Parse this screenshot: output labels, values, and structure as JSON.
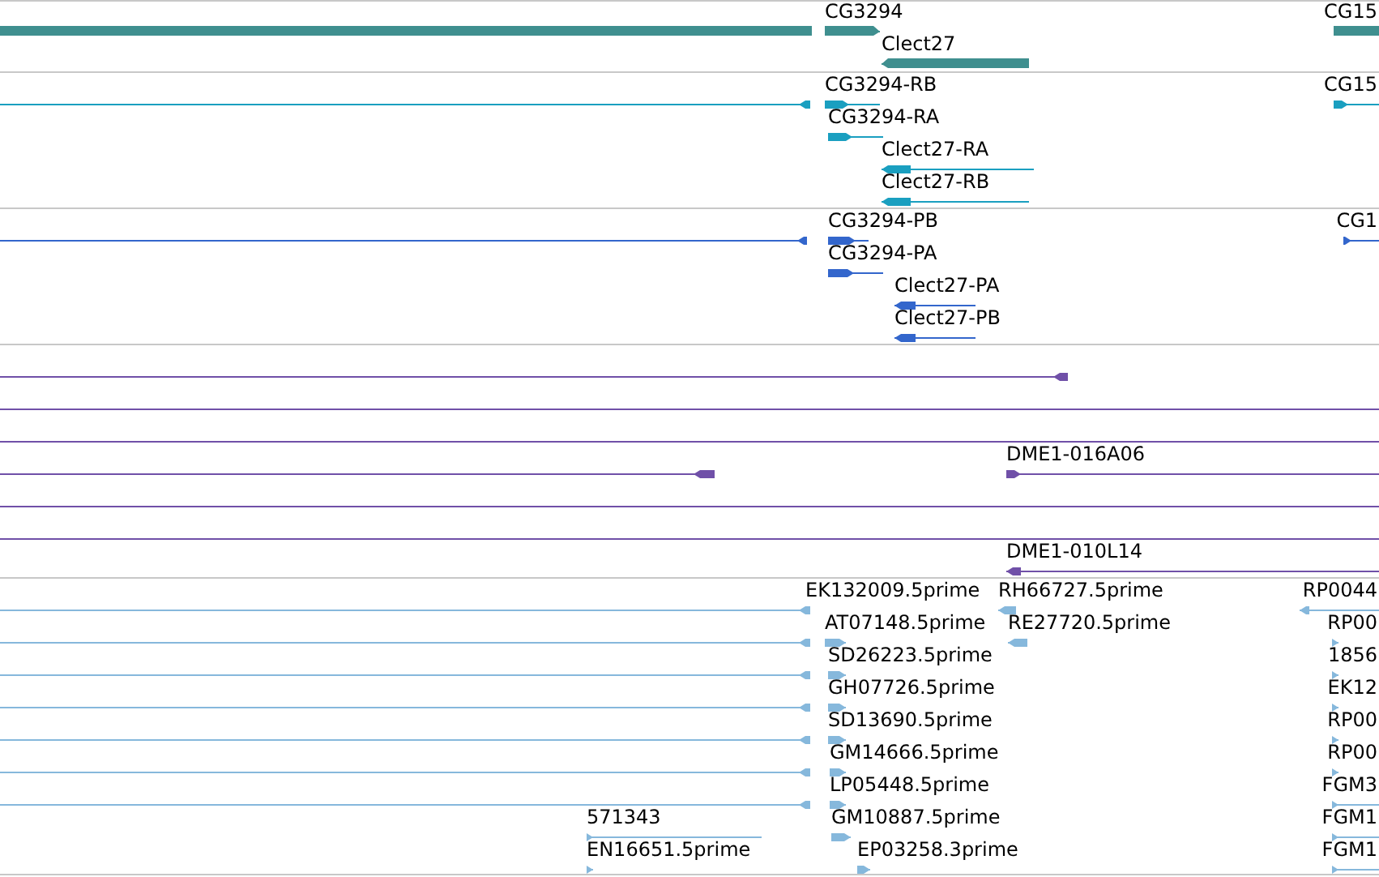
{
  "tracks": [
    {
      "kind": "gene",
      "features": [
        {
          "label": "CG3294"
        },
        {
          "label": "Clect27"
        },
        {
          "label": "CG15"
        }
      ]
    },
    {
      "kind": "transcript",
      "features": [
        {
          "label": "CG3294-RB"
        },
        {
          "label": "CG3294-RA"
        },
        {
          "label": "Clect27-RA"
        },
        {
          "label": "Clect27-RB"
        },
        {
          "label": "CG15"
        }
      ]
    },
    {
      "kind": "protein",
      "features": [
        {
          "label": "CG3294-PB"
        },
        {
          "label": "CG3294-PA"
        },
        {
          "label": "Clect27-PA"
        },
        {
          "label": "Clect27-PB"
        },
        {
          "label": "CG1"
        }
      ]
    },
    {
      "kind": "clone",
      "features": [
        {
          "label": "DME1-016A06"
        },
        {
          "label": "DME1-010L14"
        }
      ]
    },
    {
      "kind": "est",
      "features": [
        {
          "label": "EK132009.5prime"
        },
        {
          "label": "RH66727.5prime"
        },
        {
          "label": "RP0044"
        },
        {
          "label": "AT07148.5prime"
        },
        {
          "label": "RE27720.5prime"
        },
        {
          "label": "RP00"
        },
        {
          "label": "SD26223.5prime"
        },
        {
          "label": "1856"
        },
        {
          "label": "GH07726.5prime"
        },
        {
          "label": "EK12"
        },
        {
          "label": "SD13690.5prime"
        },
        {
          "label": "RP00"
        },
        {
          "label": "GM14666.5prime"
        },
        {
          "label": "RP00"
        },
        {
          "label": "LP05448.5prime"
        },
        {
          "label": "FGM3"
        },
        {
          "label": "571343"
        },
        {
          "label": "GM10887.5prime"
        },
        {
          "label": "FGM1"
        },
        {
          "label": "EN16651.5prime"
        },
        {
          "label": "EP03258.3prime"
        },
        {
          "label": "FGM1"
        }
      ]
    }
  ]
}
